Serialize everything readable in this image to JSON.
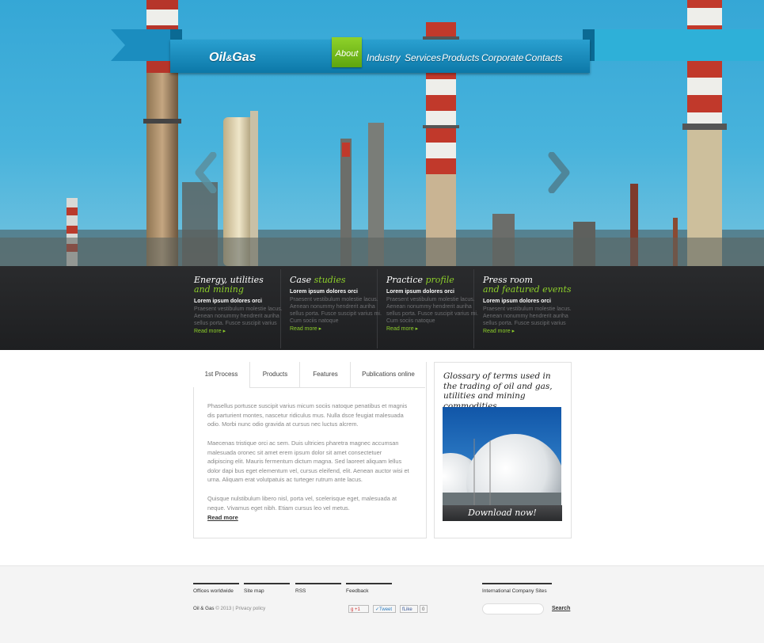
{
  "brand": {
    "logo_main_1": "Oil",
    "logo_amp": "&",
    "logo_main_2": "Gas"
  },
  "nav": {
    "items": [
      {
        "label": "About",
        "active": true
      },
      {
        "label": "Industry"
      },
      {
        "label": "Services"
      },
      {
        "label": "Products"
      },
      {
        "label": "Corporate"
      },
      {
        "label": "Contacts"
      }
    ]
  },
  "slider": {
    "prev_icon": "chevron-left-icon",
    "next_icon": "chevron-right-icon"
  },
  "features": [
    {
      "title_1": "Energy, utilities",
      "title_2": "and mining",
      "title_2_highlight": true,
      "subtitle": "Lorem ipsum dolores orci",
      "text": "Praesent vestibulum molestie lacus. Aenean nonummy hendrerit auriha sellus porta. Fusce suscipit varius",
      "more": "Read more"
    },
    {
      "title_1": "Case ",
      "title_2": "studies",
      "title_2_highlight": true,
      "subtitle": "Lorem ipsum dolores orci",
      "text": "Praesent vestibulum molestie lacus. Aenean nonummy hendrerit auriha sellus porta. Fusce suscipit varius mi. Cum sociis natoque",
      "more": "Read more"
    },
    {
      "title_1": "Practice ",
      "title_2": "profile",
      "title_2_highlight": true,
      "subtitle": "Lorem ipsum dolores orci",
      "text": "Praesent vestibulum molestie lacus. Aenean nonummy hendrerit auriha sellus porta. Fusce suscipit varius mi. Cum sociis natoque",
      "more": "Read more"
    },
    {
      "title_1": "Press room",
      "title_2": "and featured events",
      "title_2_highlight": true,
      "subtitle": "Lorem ipsum dolores orci",
      "text": "Praesent vestibulum molestie lacus. Aenean nonummy hendrerit auriha sellus porta. Fusce suscipit varius",
      "more": "Read more"
    }
  ],
  "tabs": {
    "labels": [
      "1st Process",
      "Products",
      "Features",
      "Publications online"
    ],
    "active": 0,
    "paragraphs": [
      "Phasellus portusce suscipit varius micum sociis natoque penatibus et magnis dis parturient montes, nascetur ridiculus mus. Nulla dsce feugiat malesuada odio. Morbi nunc odio gravida at cursus nec luctus alcrem.",
      "Maecenas tristique orci ac sem. Duis ultricies pharetra magnec accumsan malesuada oronec sit amet erem ipsum dolor sit amet consectetuer adipiscing elit. Mauris fermentum dictum magna. Sed laoreet aliquam lellus dolor dapi bus eget elementum vel, cursus eleifend, elit. Aenean auctor wisi et urna. Aliquam erat volutpatuis ac turteger rutrum ante lacus.",
      "Quisque nulstibulum libero nisl, porta vel, scelerisque eget, malesuada at neque. Vivamus eget nibh. Etiam cursus leo vel metus."
    ],
    "read_more": "Read more"
  },
  "glossary": {
    "title": "Glossary of terms used in the trading of oil and gas, utilities and mining commodities",
    "download": "Download now!"
  },
  "footer": {
    "links": [
      "Offices worldwide",
      "Site map",
      "RSS",
      "Feedback"
    ],
    "intl": "International Company Sites",
    "copy_brand": "Oil & Gas",
    "copy_symbol": "©",
    "copy_year": "2013",
    "copy_sep": "|",
    "privacy": "Privacy policy",
    "social": {
      "gplus": "+1",
      "tweet": "Tweet",
      "like": "Like",
      "like_count": "0"
    },
    "search_label": "Search",
    "search_value": ""
  },
  "colors": {
    "accent_green": "#8dcf2a",
    "nav_blue": "#1a8dbf",
    "dark_strip": "#242527"
  }
}
